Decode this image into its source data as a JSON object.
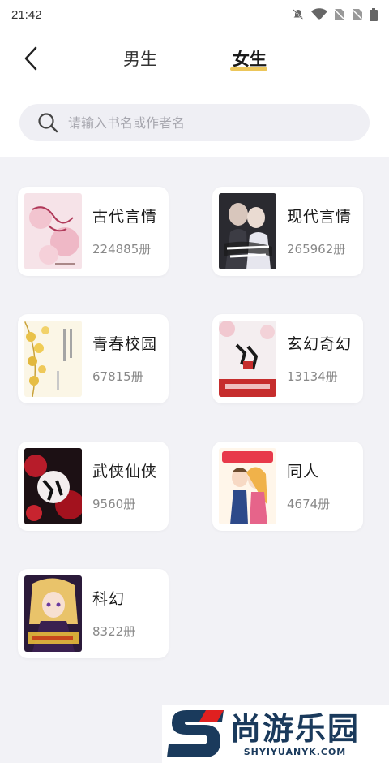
{
  "status_bar": {
    "time": "21:42"
  },
  "header": {
    "tabs": [
      {
        "label": "男生",
        "active": false
      },
      {
        "label": "女生",
        "active": true
      }
    ],
    "accent_color": "#ecc65a"
  },
  "search": {
    "placeholder": "请输入书名或作者名"
  },
  "categories": [
    {
      "title": "古代言情",
      "count": "224885册",
      "cover": "pink-blossom-cover"
    },
    {
      "title": "现代言情",
      "count": "265962册",
      "cover": "couple-dark-cover"
    },
    {
      "title": "青春校园",
      "count": "67815册",
      "cover": "ginkgo-leaves-cover"
    },
    {
      "title": "玄幻奇幻",
      "count": "13134册",
      "cover": "red-ink-xian-cover"
    },
    {
      "title": "武侠仙侠",
      "count": "9560册",
      "cover": "red-flower-cover"
    },
    {
      "title": "同人",
      "count": "4674册",
      "cover": "anime-couple-cover"
    },
    {
      "title": "科幻",
      "count": "8322册",
      "cover": "anime-girl-cover"
    }
  ],
  "watermark": {
    "cn": "尚游乐园",
    "en": "SHYIYUANYK.COM"
  }
}
